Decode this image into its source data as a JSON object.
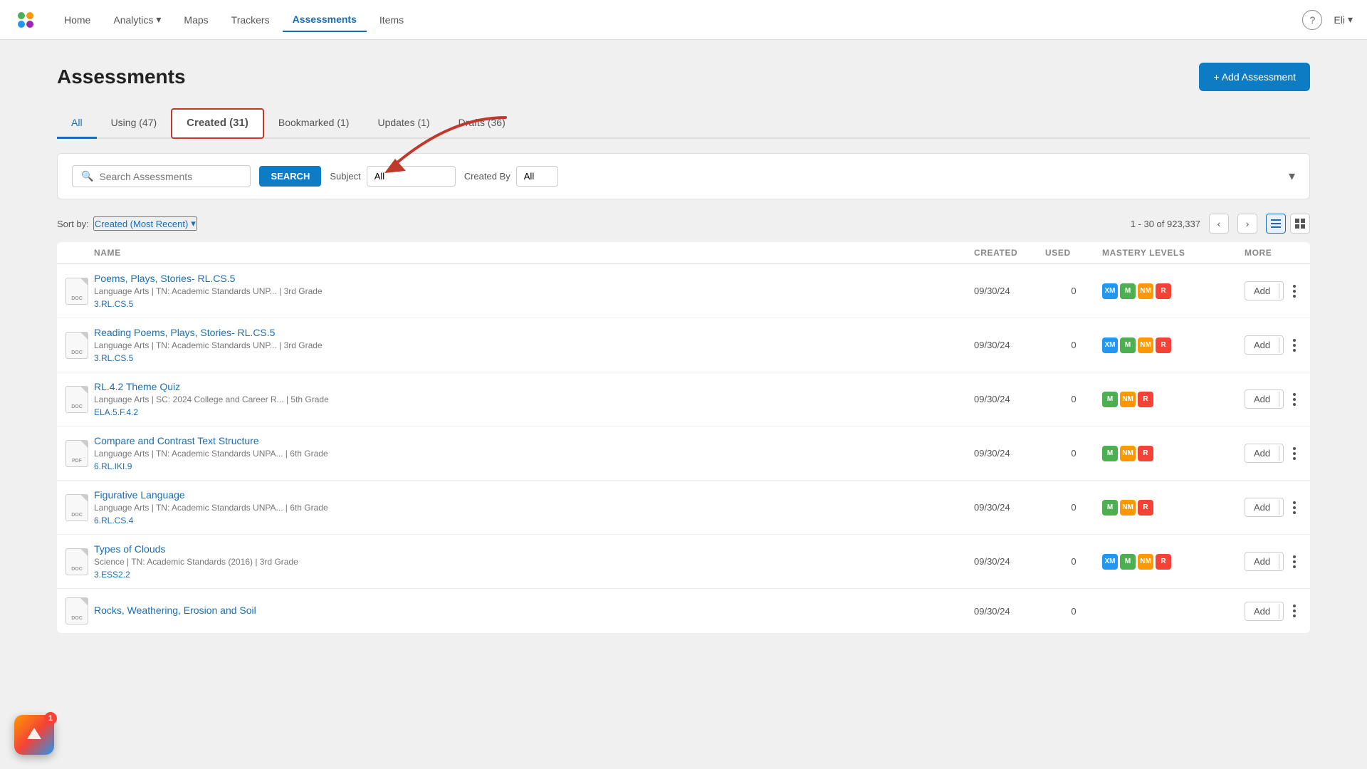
{
  "nav": {
    "logo_alt": "Logo",
    "links": [
      {
        "label": "Home",
        "active": false,
        "id": "home"
      },
      {
        "label": "Analytics",
        "active": false,
        "has_dropdown": true,
        "id": "analytics"
      },
      {
        "label": "Maps",
        "active": false,
        "id": "maps"
      },
      {
        "label": "Trackers",
        "active": false,
        "id": "trackers"
      },
      {
        "label": "Assessments",
        "active": true,
        "id": "assessments"
      },
      {
        "label": "Items",
        "active": false,
        "id": "items"
      }
    ],
    "help_label": "?",
    "user_label": "Eli"
  },
  "page": {
    "title": "Assessments",
    "add_button_label": "+ Add Assessment"
  },
  "tabs": [
    {
      "label": "All",
      "active": true,
      "highlighted": false
    },
    {
      "label": "Using (47)",
      "active": false,
      "highlighted": false
    },
    {
      "label": "Created (31)",
      "active": false,
      "highlighted": true
    },
    {
      "label": "Bookmarked (1)",
      "active": false,
      "highlighted": false
    },
    {
      "label": "Updates (1)",
      "active": false,
      "highlighted": false
    },
    {
      "label": "Drafts (36)",
      "active": false,
      "highlighted": false
    }
  ],
  "search": {
    "placeholder": "Search Assessments",
    "button_label": "SEARCH",
    "subject_label": "Subject",
    "subject_value": "All",
    "created_by_label": "Created By",
    "created_by_value": "All"
  },
  "table": {
    "sort_label": "Sort by:",
    "sort_value": "Created (Most Recent)",
    "pagination_text": "1 - 30 of 923,337",
    "columns": [
      "",
      "NAME",
      "CREATED",
      "USED",
      "MASTERY LEVELS",
      "MORE"
    ],
    "rows": [
      {
        "icon_type": "DOC",
        "title": "Poems, Plays, Stories- RL.CS.5",
        "meta": "Language Arts  |  TN: Academic Standards UNP...  |  3rd Grade",
        "standard": "3.RL.CS.5",
        "created": "09/30/24",
        "used": "0",
        "badges": [
          "XM",
          "M",
          "NM",
          "R"
        ]
      },
      {
        "icon_type": "DOC",
        "title": "Reading Poems, Plays, Stories- RL.CS.5",
        "meta": "Language Arts  |  TN: Academic Standards UNP...  |  3rd Grade",
        "standard": "3.RL.CS.5",
        "created": "09/30/24",
        "used": "0",
        "badges": [
          "XM",
          "M",
          "NM",
          "R"
        ]
      },
      {
        "icon_type": "DOC",
        "title": "RL.4.2 Theme Quiz",
        "meta": "Language Arts  |  SC: 2024 College and Career R...  |  5th Grade",
        "standard": "ELA.5.F.4.2",
        "created": "09/30/24",
        "used": "0",
        "badges": [
          "M",
          "NM",
          "R"
        ]
      },
      {
        "icon_type": "PDF",
        "title": "Compare and Contrast Text Structure",
        "meta": "Language Arts  |  TN: Academic Standards UNPA...  |  6th Grade",
        "standard": "6.RL.IKI.9",
        "created": "09/30/24",
        "used": "0",
        "badges": [
          "M",
          "NM",
          "R"
        ]
      },
      {
        "icon_type": "DOC",
        "title": "Figurative Language",
        "meta": "Language Arts  |  TN: Academic Standards UNPA...  |  6th Grade",
        "standard": "6.RL.CS.4",
        "created": "09/30/24",
        "used": "0",
        "badges": [
          "M",
          "NM",
          "R"
        ]
      },
      {
        "icon_type": "DOC",
        "title": "Types of Clouds",
        "meta": "Science  |  TN: Academic Standards (2016)  |  3rd Grade",
        "standard": "3.ESS2.2",
        "created": "09/30/24",
        "used": "0",
        "badges": [
          "XM",
          "M",
          "NM",
          "R"
        ]
      },
      {
        "icon_type": "DOC",
        "title": "Rocks, Weathering, Erosion and Soil",
        "meta": "",
        "standard": "",
        "created": "09/30/24",
        "used": "0",
        "badges": []
      }
    ]
  },
  "widget": {
    "badge_count": "1"
  }
}
